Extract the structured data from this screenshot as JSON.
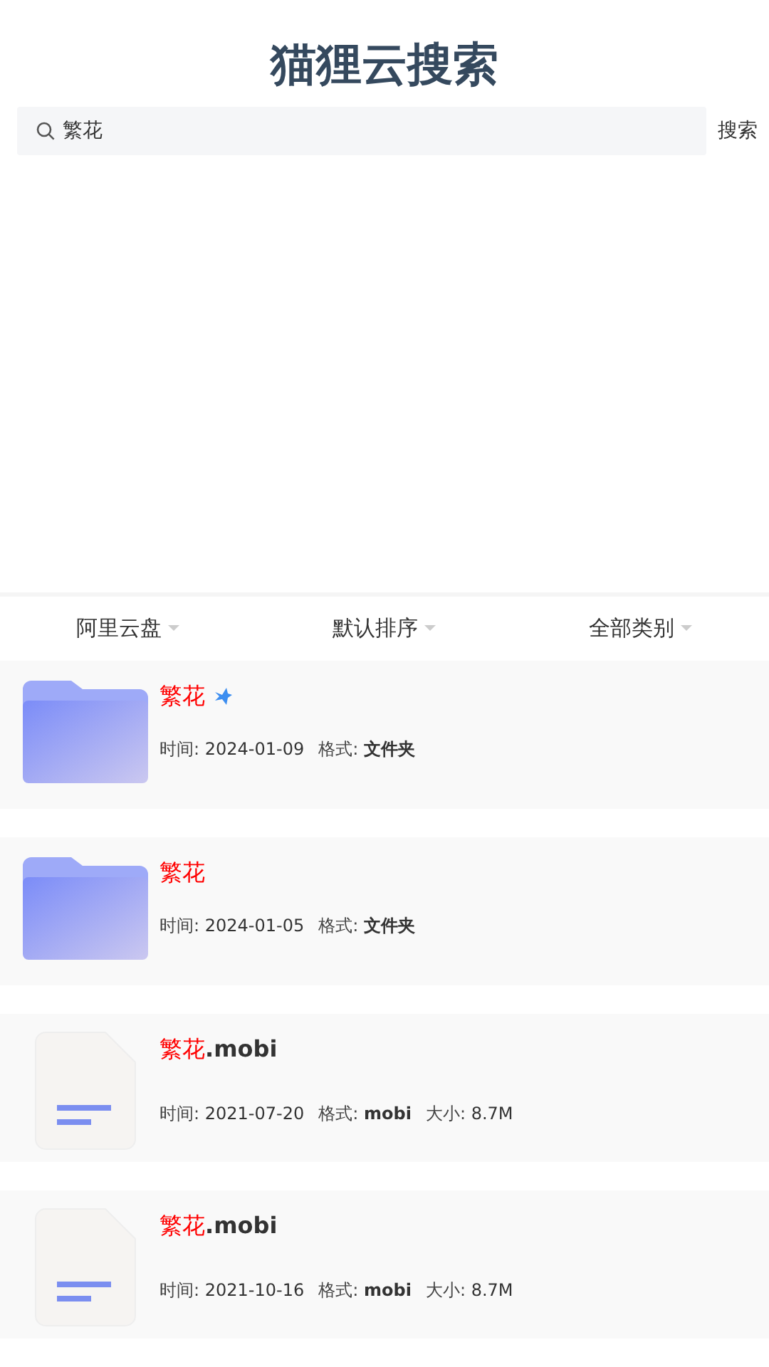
{
  "header": {
    "title": "猫狸云搜索"
  },
  "search": {
    "value": "繁花",
    "button": "搜索"
  },
  "filters": [
    {
      "label": "阿里云盘"
    },
    {
      "label": "默认排序"
    },
    {
      "label": "全部类别"
    }
  ],
  "results": [
    {
      "kind": "folder",
      "match": "繁花",
      "badge": true,
      "meta": [
        {
          "label": "时间:",
          "value": "2024-01-09",
          "bold": false
        },
        {
          "label": "格式:",
          "value": "文件夹",
          "bold": true
        }
      ]
    },
    {
      "kind": "folder",
      "match": "繁花",
      "badge": false,
      "meta": [
        {
          "label": "时间:",
          "value": "2024-01-05",
          "bold": false
        },
        {
          "label": "格式:",
          "value": "文件夹",
          "bold": true
        }
      ]
    },
    {
      "kind": "file",
      "match": "繁花",
      "rest": ".mobi",
      "badge": false,
      "meta": [
        {
          "label": "时间:",
          "value": "2021-07-20",
          "bold": false
        },
        {
          "label": "格式:",
          "value": "mobi",
          "bold": true
        },
        {
          "label": "大小:",
          "value": "8.7M",
          "bold": false
        }
      ]
    },
    {
      "kind": "file",
      "match": "繁花",
      "rest": ".mobi",
      "badge": false,
      "meta": [
        {
          "label": "时间:",
          "value": "2021-10-16",
          "bold": false
        },
        {
          "label": "格式:",
          "value": "mobi",
          "bold": true
        },
        {
          "label": "大小:",
          "value": "8.7M",
          "bold": false
        }
      ]
    }
  ]
}
